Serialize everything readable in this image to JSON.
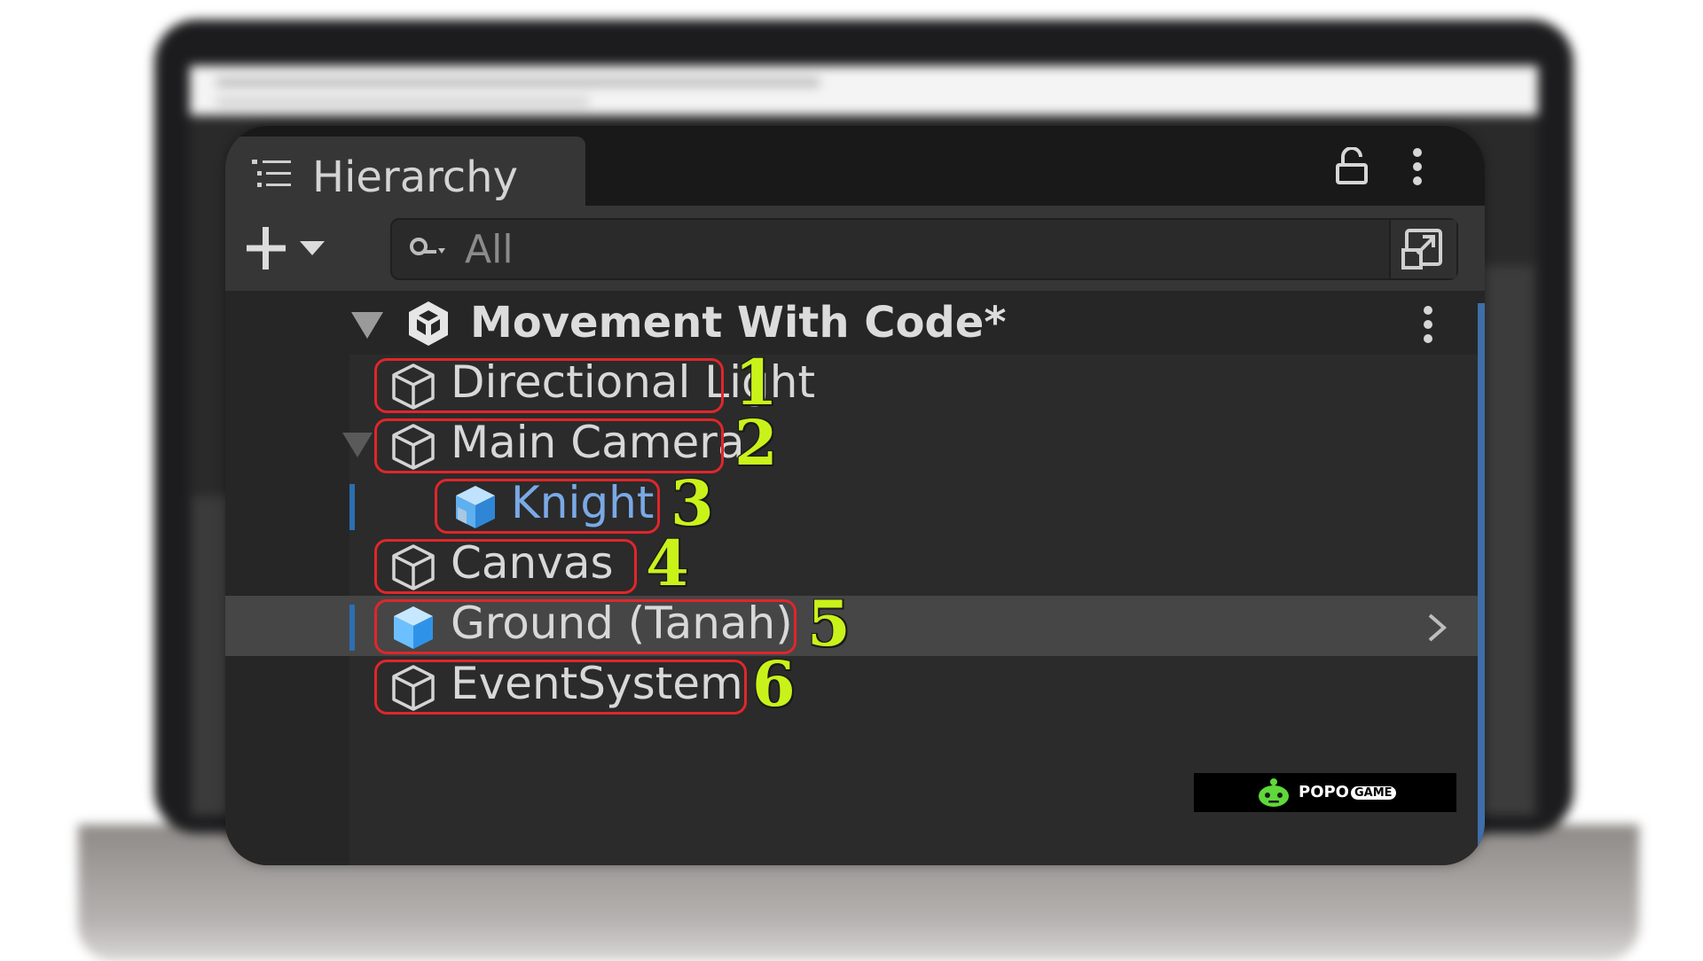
{
  "hierarchy_panel": {
    "tab_title": "Hierarchy",
    "search": {
      "placeholder": "All",
      "value": ""
    },
    "scene": {
      "name": "Movement With Code*"
    },
    "items": [
      {
        "label": "Directional Light",
        "icon": "gameobject-cube-icon",
        "annotation": "1"
      },
      {
        "label": "Main Camera",
        "icon": "gameobject-cube-icon",
        "annotation": "2",
        "expanded": true
      },
      {
        "label": "Knight",
        "icon": "prefab-icon",
        "annotation": "3",
        "is_prefab": true
      },
      {
        "label": "Canvas",
        "icon": "gameobject-cube-icon",
        "annotation": "4"
      },
      {
        "label": "Ground (Tanah)",
        "icon": "prefab-cube-icon",
        "annotation": "5",
        "selected": true
      },
      {
        "label": "EventSystem",
        "icon": "gameobject-cube-icon",
        "annotation": "6"
      }
    ]
  },
  "colors": {
    "panel_bg": "#2b2b2b",
    "prefab_text": "#7aa9e6",
    "annotation_box": "#e0262b",
    "annotation_number": "#c9f21a",
    "selection_marker": "#2c6fb0"
  },
  "watermark": {
    "text": "POPO",
    "badge": "GAME"
  }
}
